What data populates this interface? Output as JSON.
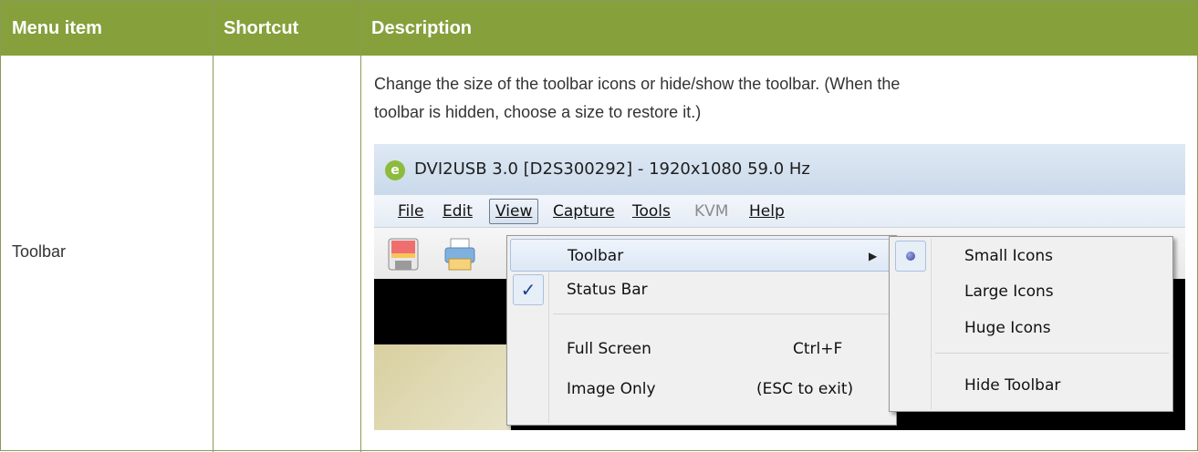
{
  "table": {
    "headers": {
      "menu_item": "Menu item",
      "shortcut": "Shortcut",
      "description": "Description"
    },
    "row": {
      "menu_item": "Toolbar",
      "shortcut": "",
      "description_line1": "Change the size of the toolbar icons or hide/show the toolbar. (When the",
      "description_line2": "toolbar is hidden, choose a size to restore it.)"
    }
  },
  "screenshot": {
    "window_title": "DVI2USB 3.0 [D2S300292]  - 1920x1080 59.0 Hz",
    "app_logo": "e",
    "menubar": {
      "file": "File",
      "edit": "Edit",
      "view": "View",
      "capture": "Capture",
      "tools": "Tools",
      "kvm": "KVM",
      "help": "Help"
    },
    "view_menu": {
      "toolbar": "Toolbar",
      "status_bar": "Status Bar",
      "status_bar_check": "✓",
      "full_screen": "Full Screen",
      "full_screen_shortcut": "Ctrl+F",
      "image_only": "Image Only",
      "image_only_shortcut": "(ESC to exit)",
      "submenu_arrow": "▶"
    },
    "toolbar_submenu": {
      "small_icons": "Small Icons",
      "large_icons": "Large Icons",
      "huge_icons": "Huge Icons",
      "hide_toolbar": "Hide Toolbar",
      "selected": "Small Icons"
    },
    "icons": [
      "save-icon",
      "print-icon"
    ],
    "colors": {
      "header": "#86a03c",
      "menu_bg": "#f0f0f0",
      "highlight_border": "#a9c1de"
    }
  }
}
